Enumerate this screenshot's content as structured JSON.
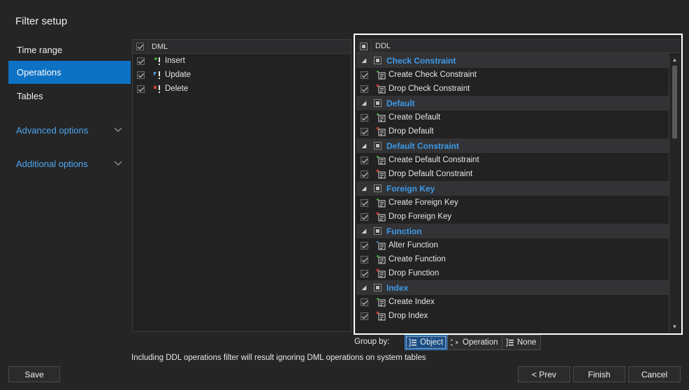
{
  "title": "Filter setup",
  "nav": {
    "items": [
      {
        "label": "Time range"
      },
      {
        "label": "Operations"
      },
      {
        "label": "Tables"
      }
    ],
    "advanced": "Advanced options",
    "additional": "Additional options"
  },
  "dml": {
    "header": "DML",
    "rows": [
      {
        "label": "Insert",
        "icon": "insert-icon"
      },
      {
        "label": "Update",
        "icon": "update-icon"
      },
      {
        "label": "Delete",
        "icon": "delete-icon"
      }
    ]
  },
  "ddl": {
    "header": "DDL",
    "groups": [
      {
        "name": "Check Constraint",
        "items": [
          "Create Check Constraint",
          "Drop Check Constraint"
        ]
      },
      {
        "name": "Default",
        "items": [
          "Create Default",
          "Drop Default"
        ]
      },
      {
        "name": "Default Constraint",
        "items": [
          "Create Default Constraint",
          "Drop Default Constraint"
        ]
      },
      {
        "name": "Foreign Key",
        "items": [
          "Create Foreign Key",
          "Drop Foreign Key"
        ]
      },
      {
        "name": "Function",
        "items": [
          "Alter Function",
          "Create Function",
          "Drop Function"
        ]
      },
      {
        "name": "Index",
        "items": [
          "Create Index",
          "Drop Index"
        ]
      }
    ]
  },
  "groupby": {
    "label": "Group by:",
    "object": "Object",
    "operation": "Operation",
    "none": "None"
  },
  "note": "Including DDL operations filter will result ignoring DML operations on system tables",
  "buttons": {
    "save": "Save",
    "prev": "< Prev",
    "finish": "Finish",
    "cancel": "Cancel"
  },
  "colors": {
    "accent": "#0e72c4",
    "link": "#4ea6f0",
    "group_header": "#3d9ae8"
  }
}
